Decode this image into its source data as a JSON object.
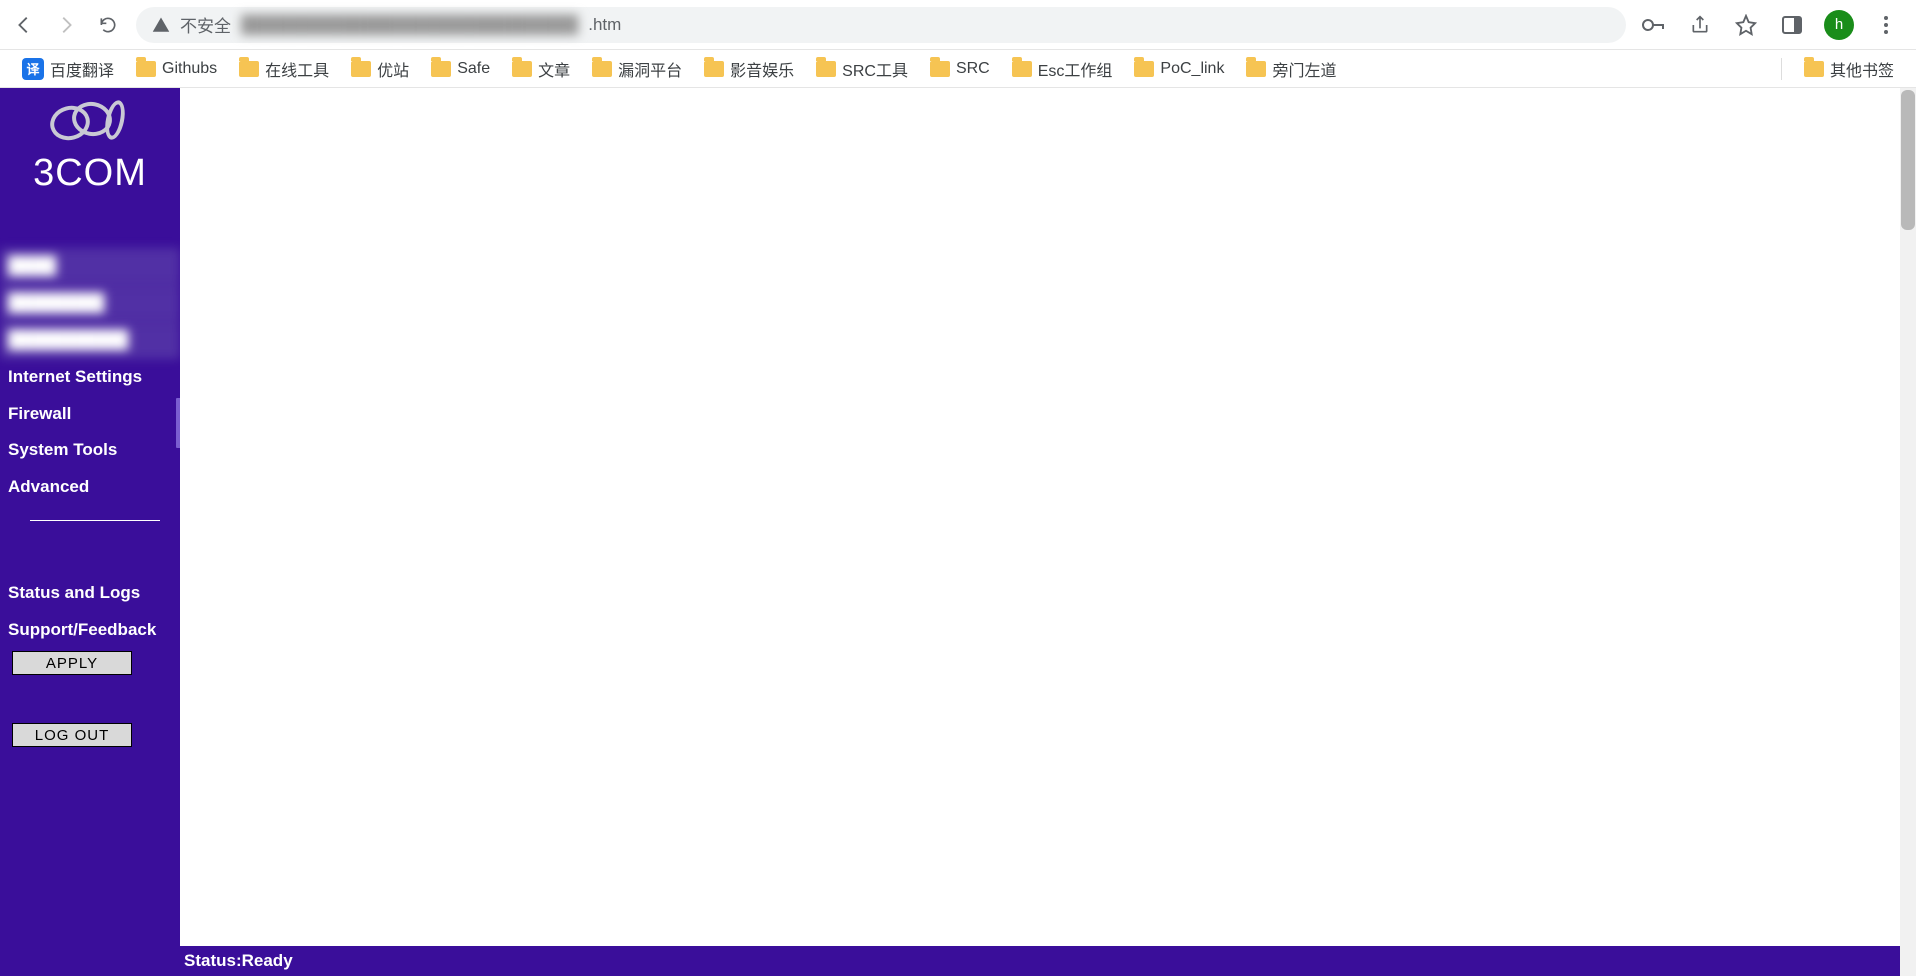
{
  "browser": {
    "security_label": "不安全",
    "url_visible_suffix": ".htm",
    "url_blur_placeholder": "████████████████████████████",
    "avatar_letter": "h"
  },
  "bookmarks": {
    "items": [
      {
        "label": "百度翻译",
        "icon": "translate"
      },
      {
        "label": "Githubs",
        "icon": "folder"
      },
      {
        "label": "在线工具",
        "icon": "folder"
      },
      {
        "label": "优站",
        "icon": "folder"
      },
      {
        "label": "Safe",
        "icon": "folder"
      },
      {
        "label": "文章",
        "icon": "folder"
      },
      {
        "label": "漏洞平台",
        "icon": "folder"
      },
      {
        "label": "影音娱乐",
        "icon": "folder"
      },
      {
        "label": "SRC工具",
        "icon": "folder"
      },
      {
        "label": "SRC",
        "icon": "folder"
      },
      {
        "label": "Esc工作组",
        "icon": "folder"
      },
      {
        "label": "PoC_link",
        "icon": "folder"
      },
      {
        "label": "旁门左道",
        "icon": "folder"
      }
    ],
    "overflow_label": "其他书签"
  },
  "app": {
    "brand": "3COM",
    "nav": {
      "items": [
        {
          "label": "████",
          "blurred": true
        },
        {
          "label": "████████",
          "blurred": true
        },
        {
          "label": "██████████",
          "blurred": true
        },
        {
          "label": "Internet Settings",
          "blurred": false
        },
        {
          "label": "Firewall",
          "blurred": false
        },
        {
          "label": "System Tools",
          "blurred": false
        },
        {
          "label": "Advanced",
          "blurred": false
        }
      ],
      "secondary": [
        {
          "label": "Status and Logs"
        },
        {
          "label": "Support/Feedback"
        }
      ]
    },
    "buttons": {
      "apply": "APPLY",
      "logout": "LOG OUT"
    },
    "status_prefix": "Status: ",
    "status_value": "Ready"
  }
}
